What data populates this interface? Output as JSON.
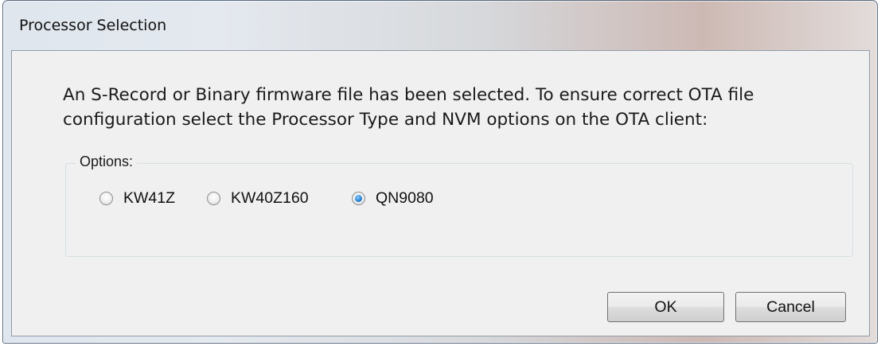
{
  "window": {
    "title": "Processor Selection"
  },
  "message": {
    "line1": "An S-Record or Binary firmware file has been selected. To ensure correct OTA file",
    "line2": "configuration select the Processor Type and NVM options on the OTA client:"
  },
  "options": {
    "label": "Options:",
    "items": [
      {
        "label": "KW41Z",
        "checked": false
      },
      {
        "label": "KW40Z160",
        "checked": false
      },
      {
        "label": "QN9080",
        "checked": true
      }
    ]
  },
  "buttons": {
    "ok": "OK",
    "cancel": "Cancel"
  },
  "colors": {
    "radio_selected": "#2a86d6"
  }
}
